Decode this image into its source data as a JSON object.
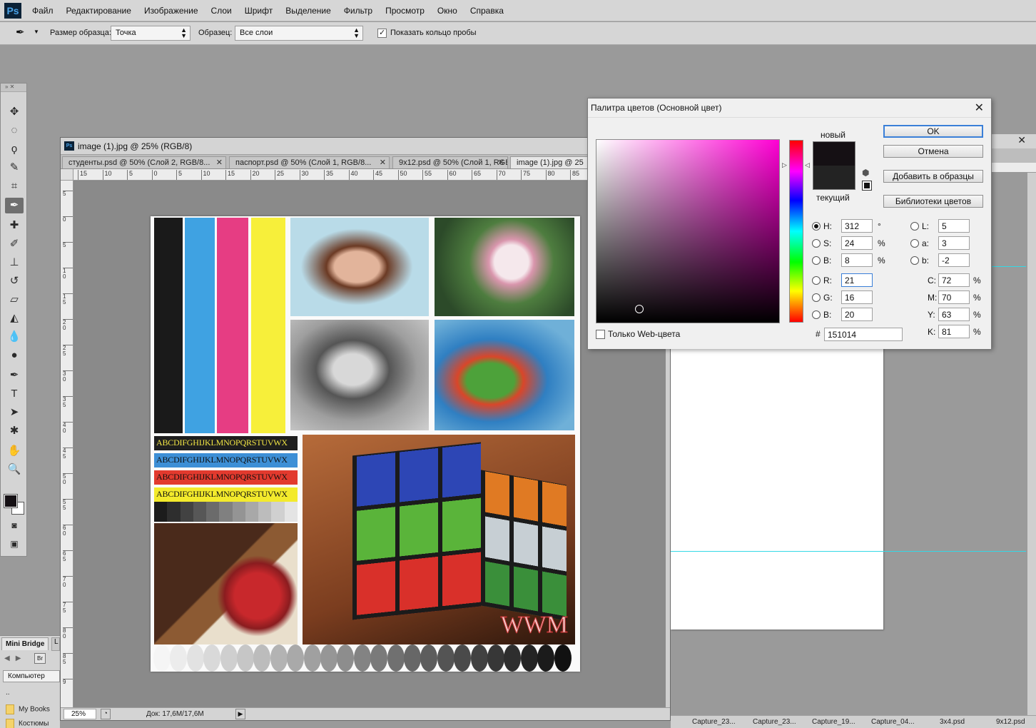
{
  "app": {
    "logo": "Ps"
  },
  "menu": [
    "Файл",
    "Редактирование",
    "Изображение",
    "Слои",
    "Шрифт",
    "Выделение",
    "Фильтр",
    "Просмотр",
    "Окно",
    "Справка"
  ],
  "options": {
    "sample_size_label": "Размер образца:",
    "sample_size_value": "Точка",
    "sample_label": "Образец:",
    "sample_value": "Все слои",
    "show_ring_label": "Показать кольцо пробы",
    "show_ring_checked": true
  },
  "tools": [
    "move-tool-icon",
    "marquee-tool-icon",
    "lasso-tool-icon",
    "quick-select-tool-icon",
    "crop-tool-icon",
    "eyedropper-tool-icon",
    "healing-brush-icon",
    "brush-tool-icon",
    "clone-stamp-icon",
    "history-brush-icon",
    "eraser-tool-icon",
    "paint-bucket-icon",
    "blur-tool-icon",
    "dodge-tool-icon",
    "pen-tool-icon",
    "type-tool-icon",
    "path-select-icon",
    "shape-tool-icon",
    "hand-tool-icon",
    "zoom-tool-icon"
  ],
  "minibridge": {
    "tab": "Mini Bridge",
    "tab2": "L",
    "br": "Br",
    "location": "Компьютер",
    "parent": "..",
    "folders": [
      "My Books",
      "Костюмы"
    ]
  },
  "document": {
    "title": "image (1).jpg @ 25% (RGB/8)",
    "tabs": [
      "студенты.psd @ 50% (Слой 2, RGB/8...",
      "паспорт.psd @ 50% (Слой 1, RGB/8...",
      "9x12.psd @ 50% (Слой 1, RGB/8...",
      "image (1).jpg @ 25"
    ],
    "ruler_h": [
      "15",
      "10",
      "5",
      "0",
      "5",
      "10",
      "15",
      "20",
      "25",
      "30",
      "35",
      "40",
      "45",
      "50",
      "55",
      "60",
      "65",
      "70",
      "75",
      "80",
      "85"
    ],
    "ruler_v": [
      "5",
      "0",
      "5",
      "1 0",
      "1 5",
      "2 0",
      "2 5",
      "3 0",
      "3 5",
      "4 0",
      "4 5",
      "5 0",
      "5 5",
      "6 0",
      "6 5",
      "7 0",
      "7 5",
      "8 0",
      "8 5",
      "9"
    ],
    "zoom": "25%",
    "status": "Док: 17,6M/17,6M",
    "image": {
      "bands": [
        "ABCDIFGHIJKLMNOPQRSTUVWX",
        "ABCDIFGHIJKLMNOPQRSTUVWX",
        "ABCDIFGHIJKLMNOPQRSTUVWX",
        "ABCDIFGHIJKLMNOPQRSTUVWX"
      ],
      "watermark": "WWM"
    }
  },
  "bottom_items": [
    "Capture_23...",
    "Capture_23...",
    "Capture_19...",
    "Capture_04...",
    "3x4.psd",
    "9x12.psd"
  ],
  "color_picker": {
    "title": "Палитра цветов (Основной цвет)",
    "new_label": "новый",
    "current_label": "текущий",
    "new_color": "#151014",
    "current_color": "#232323",
    "ok": "OK",
    "cancel": "Отмена",
    "add_swatch": "Добавить в образцы",
    "libraries": "Библиотеки цветов",
    "hsb": {
      "H": "312",
      "S": "24",
      "B": "8"
    },
    "rgb": {
      "R": "21",
      "G": "16",
      "B": "20"
    },
    "lab": {
      "L": "5",
      "a": "3",
      "b": "-2"
    },
    "cmyk": {
      "C": "72",
      "M": "70",
      "Y": "63",
      "K": "81"
    },
    "labels": {
      "H": "H:",
      "S": "S:",
      "Bhsb": "B:",
      "R": "R:",
      "G": "G:",
      "Brgb": "B:",
      "L": "L:",
      "a": "a:",
      "b": "b:",
      "C": "C:",
      "M": "M:",
      "Y": "Y:",
      "K": "K:"
    },
    "units": {
      "deg": "°",
      "pct": "%"
    },
    "web_only_label": "Только Web-цвета",
    "hex_hash": "#",
    "hex": "151014",
    "hue_color": "#ff00d4"
  }
}
